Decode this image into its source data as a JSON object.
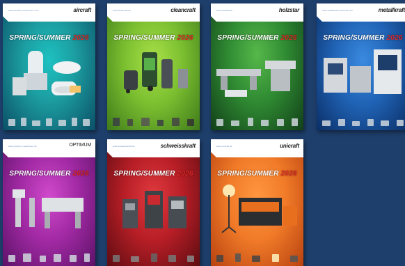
{
  "catalog_cover": {
    "title_season": "SPRING/SUMMER",
    "title_year": "2026"
  },
  "catalogs": [
    {
      "brand": "aircraft",
      "url": "www.aircraft-compressors.com",
      "color1": "#1c9ea1",
      "color2": "#0b4f66"
    },
    {
      "brand": "cleancraft",
      "url": "www.cleancraft.de",
      "color1": "#8bcb3a",
      "color2": "#3f7a1a"
    },
    {
      "brand": "holzstar",
      "url": "www.holzstar.de",
      "color1": "#3ea03a",
      "color2": "#123f19"
    },
    {
      "brand": "metallkraft",
      "url": "www.metallkraft-machines.com",
      "color1": "#2a73c7",
      "color2": "#0b2e66"
    },
    {
      "brand": "OPTIMUM",
      "url": "www.optimum-maschinen.de",
      "color1": "#b62fb3",
      "color2": "#5d1268"
    },
    {
      "brand": "schweisskraft",
      "url": "www.schweisskraft.de",
      "color1": "#c8222a",
      "color2": "#5d0d12"
    },
    {
      "brand": "unicraft",
      "url": "www.unicraft.de",
      "color1": "#f07a28",
      "color2": "#b8420f"
    }
  ]
}
